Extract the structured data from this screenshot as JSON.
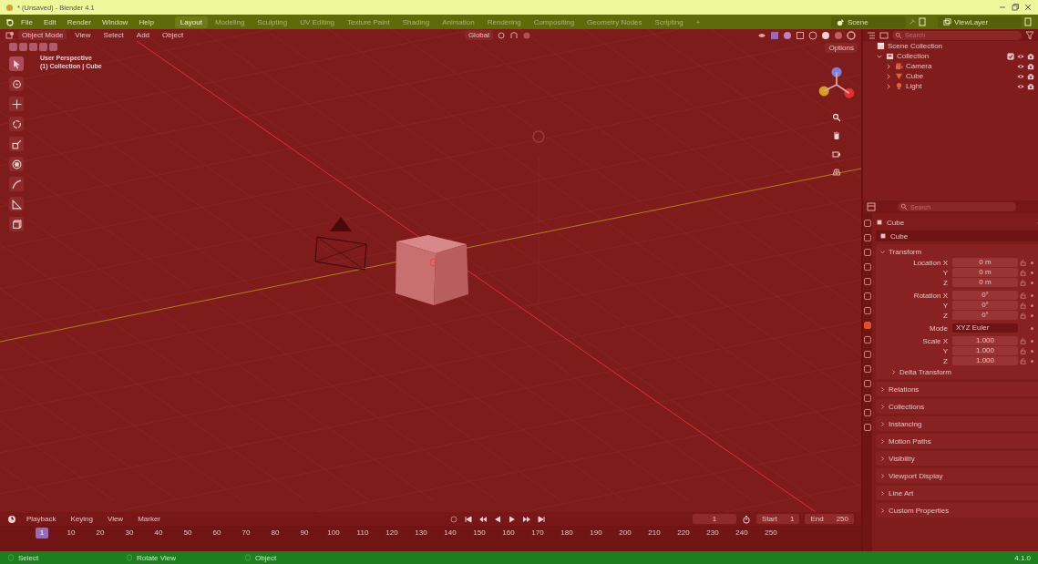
{
  "window": {
    "title": "* (Unsaved) - Blender 4.1"
  },
  "menus": [
    "File",
    "Edit",
    "Render",
    "Window",
    "Help"
  ],
  "workspaces": [
    {
      "label": "Layout",
      "selected": true
    },
    {
      "label": "Modeling",
      "selected": false
    },
    {
      "label": "Sculpting",
      "selected": false
    },
    {
      "label": "UV Editing",
      "selected": false
    },
    {
      "label": "Texture Paint",
      "selected": false
    },
    {
      "label": "Shading",
      "selected": false
    },
    {
      "label": "Animation",
      "selected": false
    },
    {
      "label": "Rendering",
      "selected": false
    },
    {
      "label": "Compositing",
      "selected": false
    },
    {
      "label": "Geometry Nodes",
      "selected": false
    },
    {
      "label": "Scripting",
      "selected": false
    }
  ],
  "add_workspace": "+",
  "scene": "Scene",
  "view_layer": "ViewLayer",
  "viewport": {
    "mode": "Object Mode",
    "menus": [
      "View",
      "Select",
      "Add",
      "Object"
    ],
    "orientation": "Global",
    "options": "Options",
    "view_name": "User Perspective",
    "context": "(1) Collection | Cube"
  },
  "outliner": {
    "search": {
      "placeholder": "Search"
    },
    "tree": [
      {
        "label": "Scene Collection",
        "kind": "scene",
        "children": [
          {
            "label": "Collection",
            "kind": "collection",
            "expanded": true,
            "checked": true,
            "children": [
              {
                "label": "Camera",
                "kind": "camera",
                "expanded": false
              },
              {
                "label": "Cube",
                "kind": "mesh",
                "expanded": false
              },
              {
                "label": "Light",
                "kind": "light",
                "expanded": false
              }
            ]
          }
        ]
      }
    ]
  },
  "properties": {
    "search": {
      "placeholder": "Search"
    },
    "object": "Cube",
    "object_field": "Cube",
    "transform": {
      "title": "Transform",
      "expanded": true,
      "rows": [
        {
          "label": "Location X",
          "value": "0 m",
          "kind": "number"
        },
        {
          "label": "Y",
          "value": "0 m",
          "kind": "number"
        },
        {
          "label": "Z",
          "value": "0 m",
          "kind": "number"
        },
        {
          "label": "Rotation X",
          "value": "0°",
          "kind": "number"
        },
        {
          "label": "Y",
          "value": "0°",
          "kind": "number"
        },
        {
          "label": "Z",
          "value": "0°",
          "kind": "number"
        },
        {
          "label": "Mode",
          "value": "XYZ Euler",
          "kind": "dropdown"
        },
        {
          "label": "Scale X",
          "value": "1.000",
          "kind": "number"
        },
        {
          "label": "Y",
          "value": "1.000",
          "kind": "number"
        },
        {
          "label": "Z",
          "value": "1.000",
          "kind": "number"
        }
      ]
    },
    "subpanel": "Delta Transform",
    "panels": [
      "Relations",
      "Collections",
      "Instancing",
      "Motion Paths",
      "Visibility",
      "Viewport Display",
      "Line Art",
      "Custom Properties"
    ]
  },
  "timeline": {
    "menus": [
      "Playback",
      "Keying",
      "View",
      "Marker"
    ],
    "current_frame": "1",
    "start_label": "Start",
    "start": "1",
    "end_label": "End",
    "end": "250",
    "ticks": [
      {
        "label": "1",
        "selected": true
      },
      {
        "label": "10",
        "selected": false
      },
      {
        "label": "20",
        "selected": false
      },
      {
        "label": "30",
        "selected": false
      },
      {
        "label": "40",
        "selected": false
      },
      {
        "label": "50",
        "selected": false
      },
      {
        "label": "60",
        "selected": false
      },
      {
        "label": "70",
        "selected": false
      },
      {
        "label": "80",
        "selected": false
      },
      {
        "label": "90",
        "selected": false
      },
      {
        "label": "100",
        "selected": false
      },
      {
        "label": "110",
        "selected": false
      },
      {
        "label": "120",
        "selected": false
      },
      {
        "label": "130",
        "selected": false
      },
      {
        "label": "140",
        "selected": false
      },
      {
        "label": "150",
        "selected": false
      },
      {
        "label": "160",
        "selected": false
      },
      {
        "label": "170",
        "selected": false
      },
      {
        "label": "180",
        "selected": false
      },
      {
        "label": "190",
        "selected": false
      },
      {
        "label": "200",
        "selected": false
      },
      {
        "label": "210",
        "selected": false
      },
      {
        "label": "220",
        "selected": false
      },
      {
        "label": "230",
        "selected": false
      },
      {
        "label": "240",
        "selected": false
      },
      {
        "label": "250",
        "selected": false
      }
    ]
  },
  "status_bar": {
    "hints": [
      "Select",
      "Rotate View",
      "Object"
    ],
    "version": "4.1.0"
  }
}
